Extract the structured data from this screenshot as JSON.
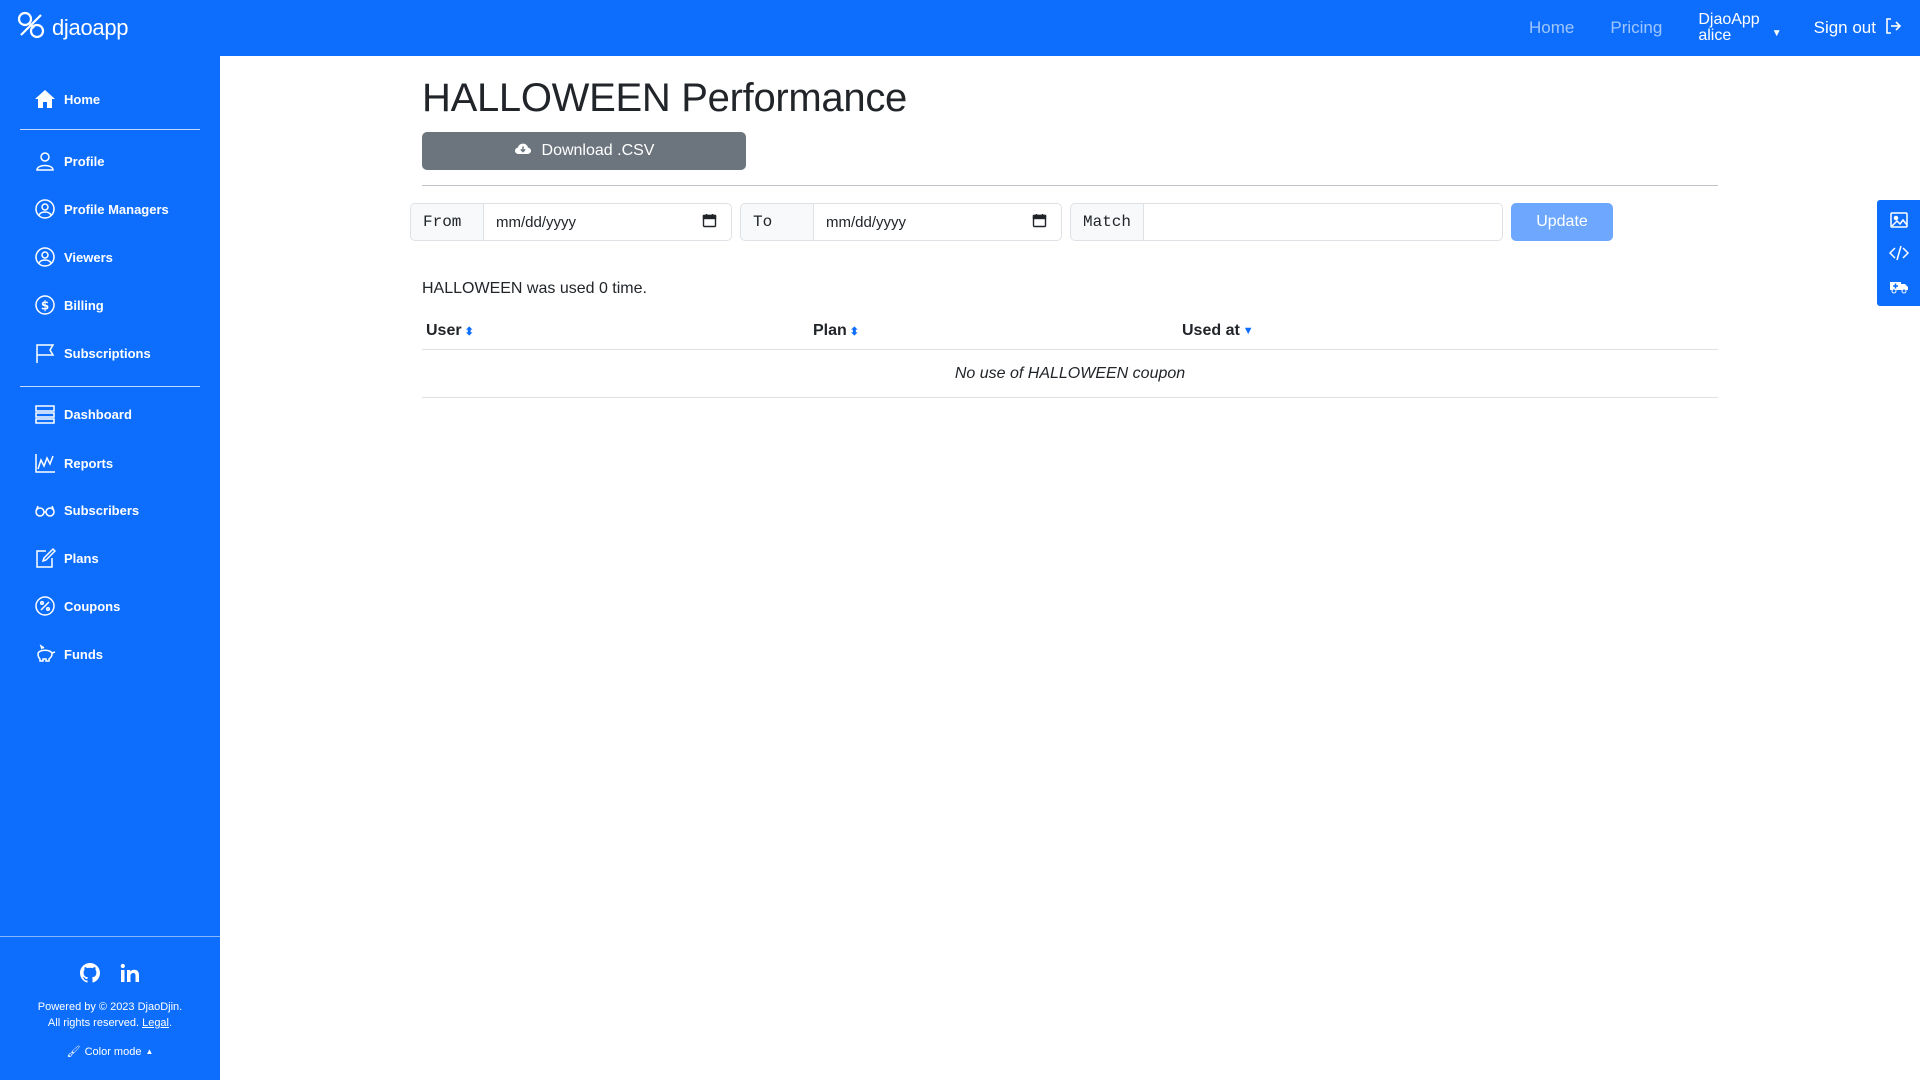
{
  "brand": {
    "name": "djaoapp",
    "icon": "djaoapp-logo-icon"
  },
  "topnav": {
    "home": "Home",
    "pricing": "Pricing",
    "account_org": "DjaoApp",
    "account_user": "alice",
    "signout": "Sign out"
  },
  "sidebar": {
    "items": [
      {
        "label": "Home",
        "icon": "home-icon"
      },
      {
        "label": "Profile",
        "icon": "person-icon"
      },
      {
        "label": "Profile Managers",
        "icon": "person-circle-icon"
      },
      {
        "label": "Viewers",
        "icon": "person-circle-icon"
      },
      {
        "label": "Billing",
        "icon": "dollar-circle-icon"
      },
      {
        "label": "Subscriptions",
        "icon": "flag-icon"
      },
      {
        "label": "Dashboard",
        "icon": "dashboard-icon"
      },
      {
        "label": "Reports",
        "icon": "chart-icon"
      },
      {
        "label": "Subscribers",
        "icon": "glasses-icon"
      },
      {
        "label": "Plans",
        "icon": "edit-icon"
      },
      {
        "label": "Coupons",
        "icon": "percent-icon"
      },
      {
        "label": "Funds",
        "icon": "piggy-bank-icon"
      }
    ],
    "footer": {
      "powered": "Powered by © 2023 DjaoDjin.",
      "rights": "All rights reserved.",
      "legal": "Legal",
      "color_mode": "Color mode"
    }
  },
  "main": {
    "title": "HALLOWEEN Performance",
    "download_label": "Download .CSV",
    "filters": {
      "from_label": "From",
      "from_value": "mm/dd/yyyy",
      "to_label": "To",
      "to_value": "mm/dd/yyyy",
      "match_label": "Match",
      "match_value": "",
      "update_label": "Update"
    },
    "summary": "HALLOWEEN was used 0 time.",
    "table": {
      "columns": [
        "User",
        "Plan",
        "Used at"
      ],
      "empty": "No use of HALLOWEEN coupon"
    }
  },
  "colors": {
    "primary": "#0d6efd",
    "secondary": "#6c757d",
    "update_disabled": "#6ea8fe"
  }
}
